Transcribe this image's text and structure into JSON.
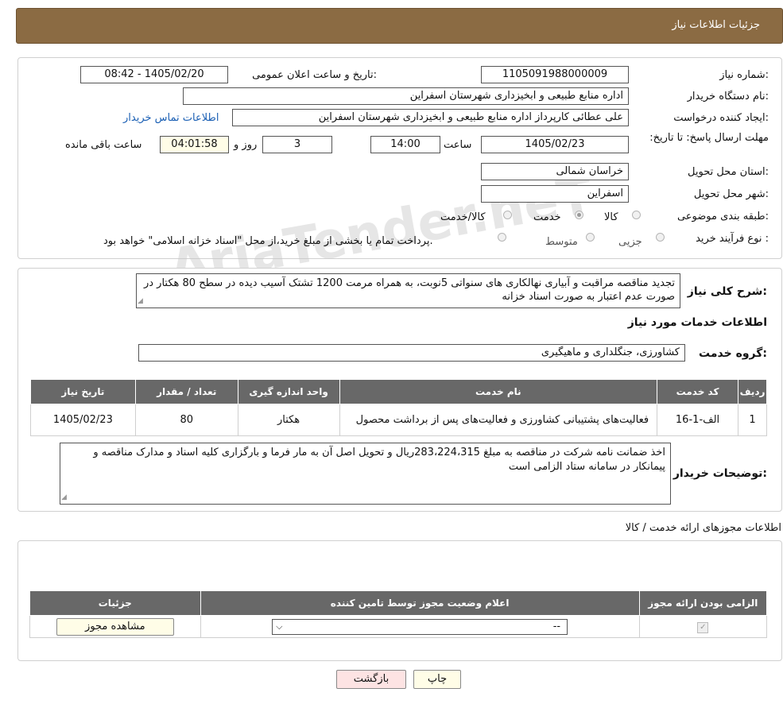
{
  "header": {
    "title": "جزئیات اطلاعات نیاز"
  },
  "info": {
    "need_number_label": "شماره نیاز:",
    "need_number": "1105091988000009",
    "announce_label": "تاریخ و ساعت اعلان عمومی:",
    "announce_value": "1405/02/20 - 08:42",
    "buyer_org_label": "نام دستگاه خریدار:",
    "buyer_org": "اداره منابع طبیعی و ابخیزداری شهرستان اسفراین",
    "creator_label": "ایجاد کننده درخواست:",
    "creator": "علی  عطائی  کارپرداز اداره منابع طبیعی و ابخیزداری شهرستان اسفراین",
    "contact_link": "اطلاعات تماس خریدار",
    "deadline_label": "مهلت ارسال پاسخ: تا تاریخ:",
    "deadline_date": "1405/02/23",
    "hour_label": "ساعت",
    "deadline_time": "14:00",
    "days": "3",
    "days_label": "روز و",
    "remaining": "04:01:58",
    "remaining_label": "ساعت باقی مانده",
    "province_label": "استان محل تحویل:",
    "province": "خراسان شمالی",
    "city_label": "شهر محل تحویل:",
    "city": "اسفراین",
    "category_label": "طبقه بندی موضوعی:",
    "category_options": [
      "کالا",
      "خدمت",
      "کالا/خدمت"
    ],
    "category_selected": "خدمت",
    "process_label": "نوع فرآیند خرید :",
    "process_options": [
      "جزیی",
      "متوسط"
    ],
    "process_note": "پرداخت تمام یا بخشی از مبلغ خرید،از محل \"اسناد خزانه اسلامی\" خواهد بود."
  },
  "watermark": "AriaTender.neT",
  "description": {
    "label": "شرح کلی نیاز:",
    "text": "تجدید مناقصه مراقبت و آبیاری نهالکاری های سنواتی  5نوبت، به همراه مرمت 1200 تشتک آسیب دیده در سطح 80 هکتار در صورت عدم اعتبار به صورت اسناد خزانه"
  },
  "services": {
    "section_title": "اطلاعات خدمات مورد نیاز",
    "group_label": "گروه خدمت:",
    "group_value": "کشاورزی، جنگلداری و ماهیگیری",
    "columns": [
      "ردیف",
      "کد خدمت",
      "نام خدمت",
      "واحد اندازه گیری",
      "تعداد / مقدار",
      "تاریخ نیاز"
    ],
    "rows": [
      {
        "row": "1",
        "code": "الف-1-16",
        "name": "فعالیت‌های پشتیبانی کشاورزی و فعالیت‌های پس از برداشت محصول",
        "unit": "هکتار",
        "qty": "80",
        "date": "1405/02/23"
      }
    ]
  },
  "buyer_notes": {
    "label": "توضیحات خریدار:",
    "text": "اخذ ضمانت نامه شرکت در مناقصه به مبلغ 283،224،315ریال و تحویل اصل آن به مار فرما و بارگزاری کلیه اسناد و مدارک مناقصه و پیمانکار در سامانه ستاد الزامی است"
  },
  "permits": {
    "section_title": "اطلاعات مجوزهای ارائه خدمت / کالا",
    "columns": [
      "الزامی بودن ارائه مجوز",
      "اعلام وضعیت مجوز توسط تامین کننده",
      "جزئیات"
    ],
    "select_value": "--",
    "view_button": "مشاهده مجوز"
  },
  "actions": {
    "print": "چاپ",
    "back": "بازگشت"
  }
}
